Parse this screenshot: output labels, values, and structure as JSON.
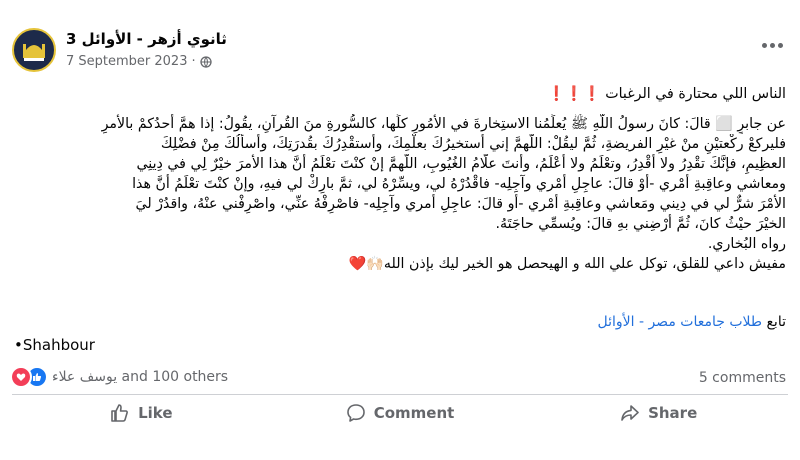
{
  "post": {
    "page_name": "ثانوي أزهر - الأوائل 3",
    "date": "7 September 2023",
    "visibility_sep": "·",
    "lines": [
      "الناس اللي محتارة في الرغبات ❗❗❗",
      "عن جابرٍ ⬜ قالَ: كانَ رسولُ اللَّهِ ﷺ يُعلِّمُنا الاستِخارةَ في الأُمُورِ كلِّها، كالسُّورةِ منَ القُرآنِ، يقُولُ: إذا همَّ أحدُكمْ بالأمرِ",
      "فليركعْ ركْعتيْنِ منْ غيْرِ الفريضةِ، ثُمَّ ليقُلْ: اللَّهمَّ إني أستخيرُكَ بعلْمِكَ، وأستقْدِرُكَ بقُدرَتِكَ، وأسألُكَ مِنْ فضْلِكَ",
      "العظِيمِ، فإنَّكَ تقْدِرُ ولا أقْدِرُ، وتعْلَمُ ولا أعْلَمُ، وأنتَ علَّامُ الغُيُوبِ، اللَّهمَّ إنْ كنْتَ تعْلَمُ أنَّ هذا الأمرَ خيْرٌ لِي في دِينِي",
      "ومعاشي وعاقِبةِ أمْري -أوْ قالَ: عاجِلِ أمْري وآجِلِه- فاقْدُرْهُ لي، ويسِّرْهُ لي، ثمَّ بارِكْ لي فيهِ، وإنْ كنْتَ تعْلَمُ أنَّ هذا",
      "الأمْرَ شرٌّ لي في دِيني ومَعاشي وعاقِبةِ أمْري -أو قالَ: عاجِلِ أمري وآجِلِه- فاصْرِفْهُ عنِّي، واصْرِفْني عنْهُ، واقدُرْ ليَ",
      "الخيْرَ حيْثُ كانَ، ثُمَّ أرْضِني بهِ قالَ: ويُسمِّي حاجَتَهُ.",
      "رواه البُخاري.",
      "مفيش داعي للقلق، توكل علي الله و الهيحصل هو الخير ليك بإذن الله🙌🏻❤️"
    ],
    "follow_prefix": "تابع",
    "follow_link": "طلاب جامعات مصر - الأوائل",
    "hashtag": "•Shahbour",
    "reactors": "يوسف علاء and 100 others",
    "comments": "5 comments"
  },
  "actions": {
    "like": "Like",
    "comment": "Comment",
    "share": "Share"
  },
  "colors": {
    "link": "#216fdb",
    "love": "#f33e58",
    "like": "#1877f2",
    "secondary_text": "#65676b"
  }
}
